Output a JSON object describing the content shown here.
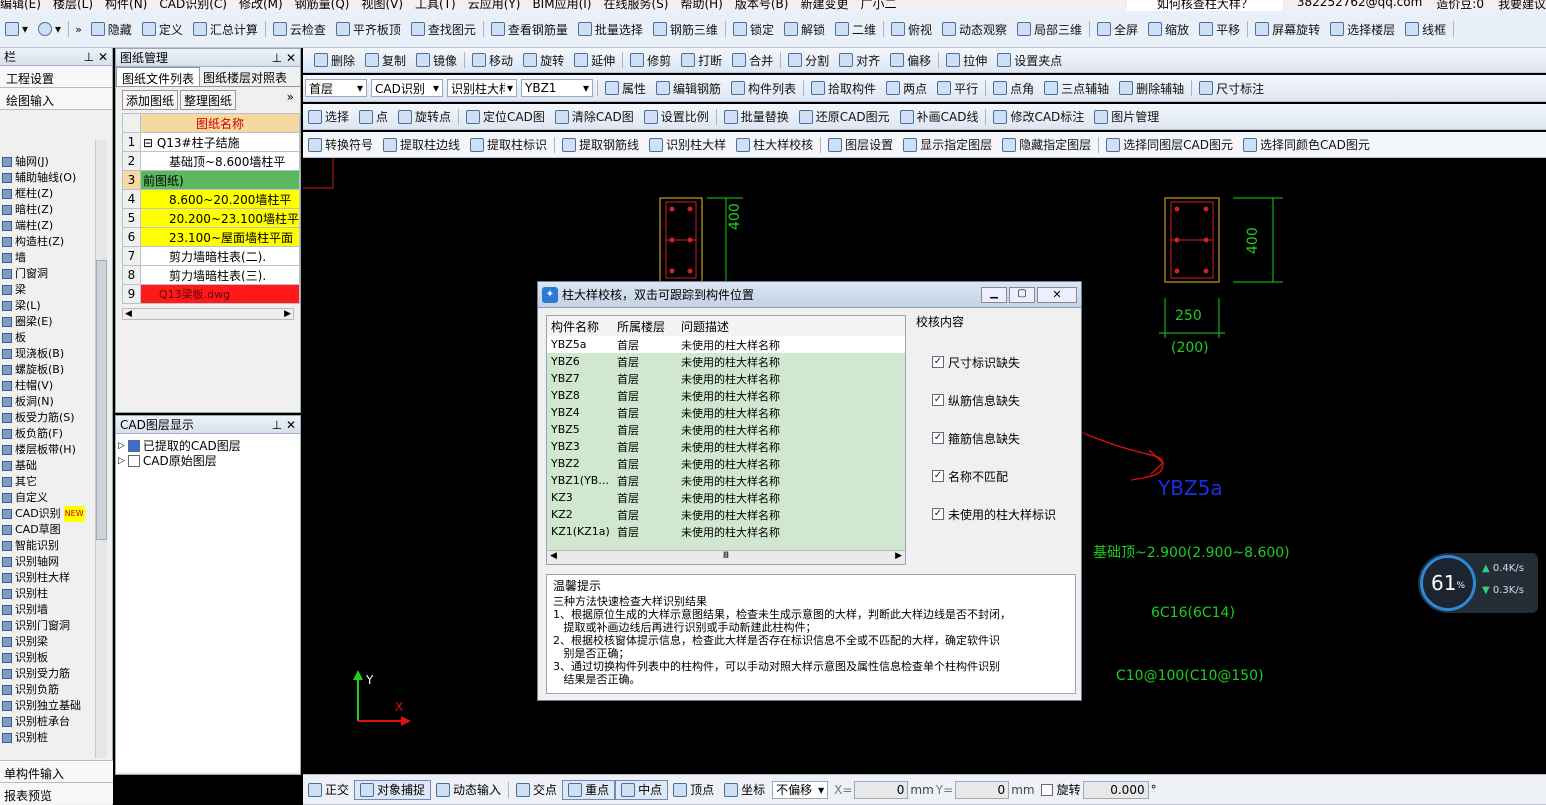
{
  "menubar": {
    "items": [
      "编辑(E)",
      "楼层(L)",
      "构件(N)",
      "CAD识别(C)",
      "修改(M)",
      "钢筋量(Q)",
      "视图(V)",
      "工具(T)",
      "云应用(Y)",
      "BIM应用(I)",
      "在线服务(S)",
      "帮助(H)",
      "版本号(B)",
      "新建变更",
      "广小二"
    ],
    "search_text": "如何核查柱大样？",
    "account": "382252762@qq.com",
    "coins": "造价豆:0",
    "suggest": "我要建议"
  },
  "toolbar1": [
    "隐藏",
    "定义",
    "汇总计算",
    "云检查",
    "平齐板顶",
    "查找图元",
    "查看钢筋量",
    "批量选择",
    "钢筋三维",
    "锁定",
    "解锁",
    "二维",
    "俯视",
    "动态观察",
    "局部三维",
    "全屏",
    "缩放",
    "平移",
    "屏幕旋转",
    "选择楼层",
    "线框"
  ],
  "toolbar2": [
    "删除",
    "复制",
    "镜像",
    "移动",
    "旋转",
    "延伸",
    "修剪",
    "打断",
    "合并",
    "分割",
    "对齐",
    "偏移",
    "拉伸",
    "设置夹点"
  ],
  "toolbar3": {
    "floor": "首层",
    "mode": "CAD识别",
    "type": "识别柱大样",
    "member": "YBZ1",
    "items": [
      "属性",
      "编辑钢筋",
      "构件列表",
      "拾取构件",
      "两点",
      "平行",
      "点角",
      "三点辅轴",
      "删除辅轴",
      "尺寸标注"
    ]
  },
  "toolbar4": [
    "选择",
    "点",
    "旋转点",
    "定位CAD图",
    "清除CAD图",
    "设置比例",
    "批量替换",
    "还原CAD图元",
    "补画CAD线",
    "修改CAD标注",
    "图片管理"
  ],
  "toolbar5": [
    "转换符号",
    "提取柱边线",
    "提取柱标识",
    "提取钢筋线",
    "识别柱大样",
    "柱大样校核",
    "图层设置",
    "显示指定图层",
    "隐藏指定图层",
    "选择同图层CAD图元",
    "选择同颜色CAD图元"
  ],
  "left_panel": {
    "title": "栏",
    "tabs": [
      "工程设置",
      "绘图输入"
    ],
    "tree": [
      "轴网(J)",
      "辅助轴线(O)",
      "框柱(Z)",
      "暗柱(Z)",
      "端柱(Z)",
      "构造柱(Z)",
      "墙",
      "门窗洞",
      "梁",
      "梁(L)",
      "圈梁(E)",
      "板",
      "现浇板(B)",
      "螺旋板(B)",
      "柱帽(V)",
      "板洞(N)",
      "板受力筋(S)",
      "板负筋(F)",
      "楼层板带(H)",
      "基础",
      "其它",
      "自定义",
      "CAD识别",
      "CAD草图",
      "智能识别",
      "识别轴网",
      "识别柱大样",
      "识别柱",
      "识别墙",
      "识别门窗洞",
      "识别梁",
      "识别板",
      "识别受力筋",
      "识别负筋",
      "识别独立基础",
      "识别桩承台",
      "识别桩"
    ],
    "bottom": [
      "单构件输入",
      "报表预览"
    ],
    "new_badge": "NEW"
  },
  "drawing_panel": {
    "title": "图纸管理",
    "tabs": [
      "图纸文件列表",
      "图纸楼层对照表"
    ],
    "buttons": [
      "添加图纸",
      "整理图纸"
    ],
    "col_header": "图纸名称",
    "rows": [
      {
        "num": "1",
        "name": "⊟ Q13#柱子结施"
      },
      {
        "num": "2",
        "name": "基础顶~8.600墙柱平"
      },
      {
        "num": "3",
        "name": "前图纸)"
      },
      {
        "num": "4",
        "name": "8.600~20.200墙柱平"
      },
      {
        "num": "5",
        "name": "20.200~23.100墙柱平"
      },
      {
        "num": "6",
        "name": "23.100~屋面墙柱平面"
      },
      {
        "num": "7",
        "name": "剪力墙暗柱表(二)."
      },
      {
        "num": "8",
        "name": "剪力墙暗柱表(三)."
      },
      {
        "num": "9",
        "name": "Q13梁板.dwg"
      }
    ]
  },
  "layer_panel": {
    "title": "CAD图层显示",
    "items": [
      "已提取的CAD图层",
      "CAD原始图层"
    ]
  },
  "cad": {
    "dim1": "400",
    "dim2": "400",
    "dim3": "250",
    "dim3b": "(200)",
    "label": "YBZ5a",
    "elev": "基础顶~2.900(2.900~8.600)",
    "rebar": "6C16(6C14)",
    "stirrup": "C10@100(C10@150)",
    "axis_y": "Y",
    "axis_x": "X"
  },
  "dialog": {
    "title": "柱大样校核，双击可跟踪到构件位置",
    "headers": [
      "构件名称",
      "所属楼层",
      "问题描述"
    ],
    "rows": [
      [
        "YBZ5a",
        "首层",
        "未使用的柱大样名称"
      ],
      [
        "YBZ6",
        "首层",
        "未使用的柱大样名称"
      ],
      [
        "YBZ7",
        "首层",
        "未使用的柱大样名称"
      ],
      [
        "YBZ8",
        "首层",
        "未使用的柱大样名称"
      ],
      [
        "YBZ4",
        "首层",
        "未使用的柱大样名称"
      ],
      [
        "YBZ5",
        "首层",
        "未使用的柱大样名称"
      ],
      [
        "YBZ3",
        "首层",
        "未使用的柱大样名称"
      ],
      [
        "YBZ2",
        "首层",
        "未使用的柱大样名称"
      ],
      [
        "YBZ1(YB...",
        "首层",
        "未使用的柱大样名称"
      ],
      [
        "KZ3",
        "首层",
        "未使用的柱大样名称"
      ],
      [
        "KZ2",
        "首层",
        "未使用的柱大样名称"
      ],
      [
        "KZ1(KZ1a)",
        "首层",
        "未使用的柱大样名称"
      ]
    ],
    "check_title": "校核内容",
    "checks": [
      "尺寸标识缺失",
      "纵筋信息缺失",
      "箍筋信息缺失",
      "名称不匹配",
      "未使用的柱大样标识"
    ],
    "tip_title": "温馨提示",
    "tips": [
      "三种方法快速检查大样识别结果",
      "1、根据原位生成的大样示意图结果，检查未生成示意图的大样，判断此大样边线是否不封闭，",
      "   提取或补画边线后再进行识别或手动新建此柱构件；",
      "2、根据校核窗体提示信息，检查此大样是否存在标识信息不全或不匹配的大样，确定软件识",
      "   别是否正确；",
      "3、通过切换构件列表中的柱构件，可以手动对照大样示意图及属性信息检查单个柱构件识别",
      "   结果是否正确。"
    ]
  },
  "speed": {
    "percent": "61",
    "unit": "%",
    "up": "0.4",
    "down": "0.3",
    "rate_unit": "K/s"
  },
  "statusbar": {
    "items": [
      "正交",
      "对象捕捉",
      "动态输入",
      "交点",
      "重点",
      "中点",
      "顶点",
      "坐标"
    ],
    "offset": "不偏移",
    "x_label": "X=",
    "x_val": "0",
    "y_label": "Y=",
    "y_val": "0",
    "unit": "mm",
    "rotate": "旋转",
    "rot_val": "0.000",
    "deg": "°"
  },
  "colors": {
    "cad_green": "#1ccf1c",
    "label_blue": "#1a2fe0",
    "annot_red": "#e01010",
    "highlight_yellow": "#ffff00"
  }
}
